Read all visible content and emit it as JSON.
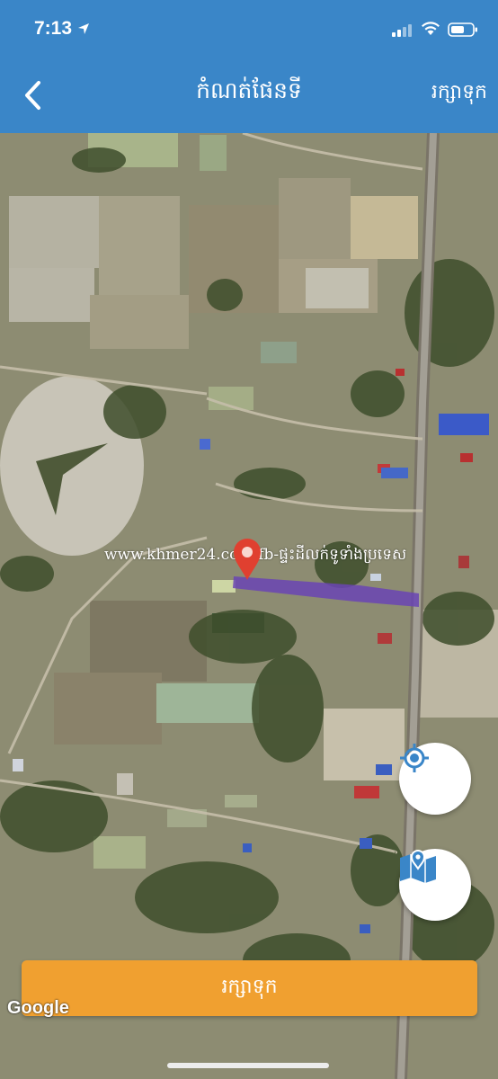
{
  "status_bar": {
    "time": "7:13"
  },
  "header": {
    "title": "កំណត់ផែនទី",
    "save_label": "រក្សាទុក"
  },
  "map": {
    "watermark": "www.khmer24.com/fb-ផ្ទះដីលក់ទូទាំងប្រទេស",
    "provider_logo": "Google"
  },
  "actions": {
    "save_button_label": "រក្សាទុក"
  },
  "icons": {
    "back": "chevron-left-icon",
    "locate": "crosshair-icon",
    "map_type": "map-pin-icon",
    "pin": "map-marker-icon"
  },
  "colors": {
    "header": "#3a86c8",
    "save_button": "#f0a030",
    "plot": "#6a44b4",
    "pin": "#e04030"
  }
}
